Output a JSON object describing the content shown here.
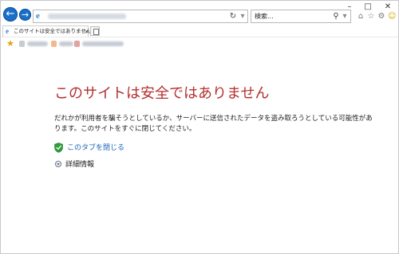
{
  "address_bar": {
    "search_placeholder": "検索..."
  },
  "tab": {
    "title": "このサイトは安全ではありません"
  },
  "warning": {
    "title": "このサイトは安全ではありません",
    "body": "だれかが利用者を騙そうとしているか、サーバーに送信されたデータを盗み取ろうとしている可能性があります。このサイトをすぐに閉じてください。",
    "close_tab_label": "このタブを閉じる",
    "details_label": "詳細情報"
  },
  "colors": {
    "title_red": "#b52f2f",
    "link_blue": "#1a63b8",
    "nav_blue": "#1a6fc8",
    "shield_green": "#2e9d3a"
  },
  "icons": [
    "back-arrow-icon",
    "forward-arrow-icon",
    "ie-logo-icon",
    "refresh-icon",
    "search-icon",
    "home-icon",
    "star-icon",
    "gear-icon",
    "smiley-icon",
    "shield-icon",
    "chevron-down-icon"
  ]
}
